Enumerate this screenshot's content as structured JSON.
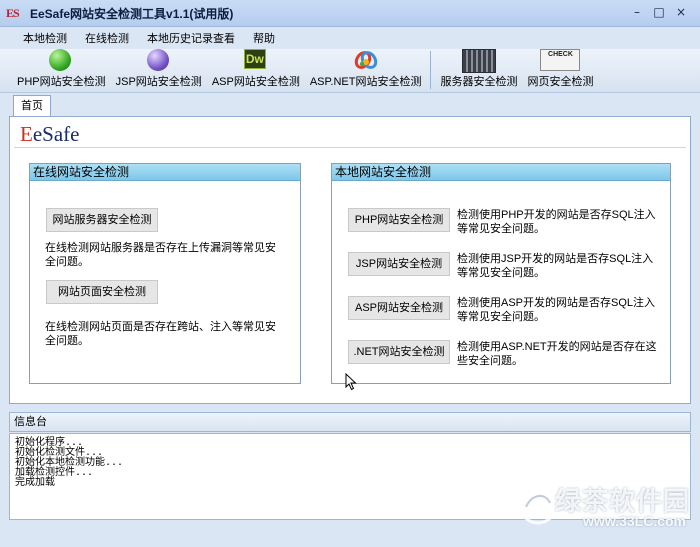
{
  "window": {
    "title": "EeSafe网站安全检测工具v1.1(试用版)",
    "icon_text": "ES",
    "controls": [
      "–",
      "□",
      "×"
    ]
  },
  "menu": [
    "本地检测",
    "在线检测",
    "本地历史记录查看",
    "帮助"
  ],
  "toolbar": [
    {
      "label": "PHP网站安全检测",
      "icon": "green-orb-icon"
    },
    {
      "label": "JSP网站安全检测",
      "icon": "purple-orb-icon"
    },
    {
      "label": "ASP网站安全检测",
      "icon": "dreamweaver-icon"
    },
    {
      "label": "ASP.NET网站安全检测",
      "icon": "dotnet-icon"
    },
    {
      "label": "服务器安全检测",
      "icon": "server-rack-icon"
    },
    {
      "label": "网页安全检测",
      "icon": "check-stamp-icon",
      "icon_text": "CHECK"
    }
  ],
  "tab": "首页",
  "logo": {
    "first": "E",
    "rest": "eSafe"
  },
  "online": {
    "title": "在线网站安全检测",
    "server_button": "网站服务器安全检测",
    "server_desc": "在线检测网站服务器是否存在上传漏洞等常见安全问题。",
    "page_button": "网站页面安全检测",
    "page_desc": "在线检测网站页面是否存在跨站、注入等常见安全问题。"
  },
  "local": {
    "title": "本地网站安全检测",
    "items": [
      {
        "button": "PHP网站安全检测",
        "desc": "检测使用PHP开发的网站是否存SQL注入等常见安全问题。"
      },
      {
        "button": "JSP网站安全检测",
        "desc": "检测使用JSP开发的网站是否存SQL注入等常见安全问题。"
      },
      {
        "button": "ASP网站安全检测",
        "desc": "检测使用ASP开发的网站是否存SQL注入等常见安全问题。"
      },
      {
        "button": ".NET网站安全检测",
        "desc": "检测使用ASP.NET开发的网站是否存在这些安全问题。"
      }
    ]
  },
  "console": {
    "title": "信息台",
    "lines": [
      "初始化程序...",
      "初始化检测文件...",
      "初始化本地检测功能...",
      "加载检测控件...",
      "完成加载"
    ]
  },
  "watermark": {
    "main": "绿茶软件园",
    "url": "www.33LC.com"
  }
}
